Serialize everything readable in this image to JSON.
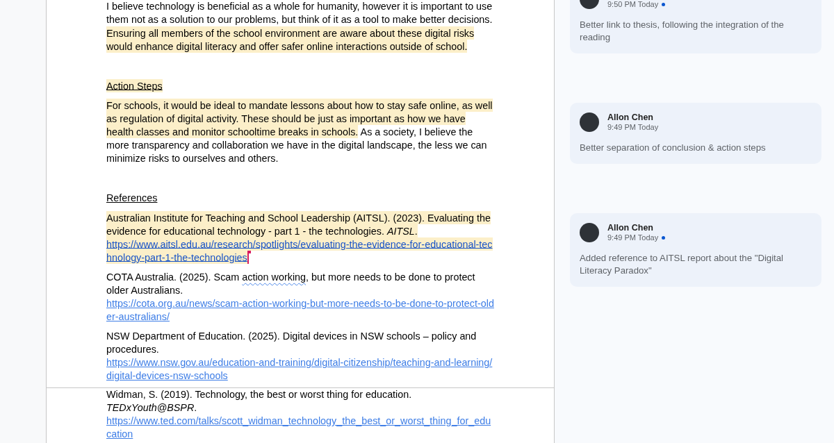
{
  "document": {
    "pages": [
      {
        "blocks": [
          {
            "kind": "paragraph",
            "segments": [
              {
                "text": "I believe technology is beneficial as a whole for humanity, however it is important to use them not as a solution to our problems, but think of it as a tool to make better decisions. ",
                "highlighted": false,
                "flagged": false
              },
              {
                "text": "Ensuring all members of the school environment are aware about these digital risks would enhance digital literacy and offer safer online interactions outside of school.",
                "highlighted": true,
                "flagged": false
              }
            ]
          },
          {
            "kind": "blank"
          },
          {
            "kind": "heading",
            "segments": [
              {
                "text": "Action Steps",
                "highlighted": true,
                "flagged": false
              }
            ]
          },
          {
            "kind": "paragraph",
            "segments": [
              {
                "text": "For schools, it would be ideal to mandate lessons about how to stay safe online, as well as regulation of digital activity. These should be just as important as how we have health classes and monitor schooltime breaks in schools.",
                "highlighted": true,
                "flagged": false
              },
              {
                "text": " As a society, I believe the more transparency and collaboration we have in the digital landscape, the less we can minimize risks to ourselves and others.",
                "highlighted": false,
                "flagged": false
              }
            ]
          },
          {
            "kind": "blank"
          },
          {
            "kind": "heading",
            "segments": [
              {
                "text": "References",
                "highlighted": false,
                "flagged": false
              }
            ]
          },
          {
            "kind": "reference",
            "segments": [
              {
                "text": "Australian Institute for Teaching and School Leadership (AITSL). (2023). Evaluating the evidence for educational technology - part 1 - the technologies. *AITSL*.",
                "highlighted": true,
                "flagged": false
              }
            ],
            "url": {
              "text": "https://www.aitsl.edu.au/research/spotlights/evaluating-the-evidence-for-educational-technology-part-1-the-technologies",
              "highlighted": true
            },
            "cursor": true
          },
          {
            "kind": "reference",
            "segments": [
              {
                "text": "COTA Australia. (2025). Scam ",
                "highlighted": false,
                "flagged": false
              },
              {
                "text": "action working",
                "highlighted": false,
                "flagged": true
              },
              {
                "text": ", but more needs to be done to protect older Australians.",
                "highlighted": false,
                "flagged": false
              }
            ],
            "url": {
              "text": "https://cota.org.au/news/scam-action-working-but-more-needs-to-be-done-to-protect-older-australians/",
              "highlighted": false
            },
            "cursor": false
          },
          {
            "kind": "reference",
            "segments": [
              {
                "text": "NSW Department of Education. (2025). Digital devices in NSW schools – policy and procedures.",
                "highlighted": false,
                "flagged": false
              }
            ],
            "url": {
              "text": "https://www.nsw.gov.au/education-and-training/digital-citizenship/teaching-and-learning/digital-devices-nsw-schools",
              "highlighted": false
            },
            "cursor": false
          }
        ]
      },
      {
        "blocks": [
          {
            "kind": "reference",
            "segments": [
              {
                "text": "Widman, S. (2019). Technology, the best or worst thing for education. *TEDxYouth@BSPR*.",
                "highlighted": false,
                "flagged": false
              }
            ],
            "url": {
              "text": "https://www.ted.com/talks/scott_widman_technology_the_best_or_worst_thing_for_education",
              "highlighted": false
            },
            "cursor": false
          }
        ]
      }
    ]
  },
  "comments": [
    {
      "time": "9:50 PM Today",
      "unread": true,
      "text": "Better link to thesis, following the integration of the reading"
    },
    {
      "author": "Allon Chen",
      "time": "9:49 PM Today",
      "unread": false,
      "text": "Better separation of conclusion & action steps"
    },
    {
      "author": "Allon Chen",
      "time": "9:49 PM Today",
      "unread": true,
      "text": "Added reference to AITSL report about the \"Digital Literacy Paradox\""
    }
  ]
}
